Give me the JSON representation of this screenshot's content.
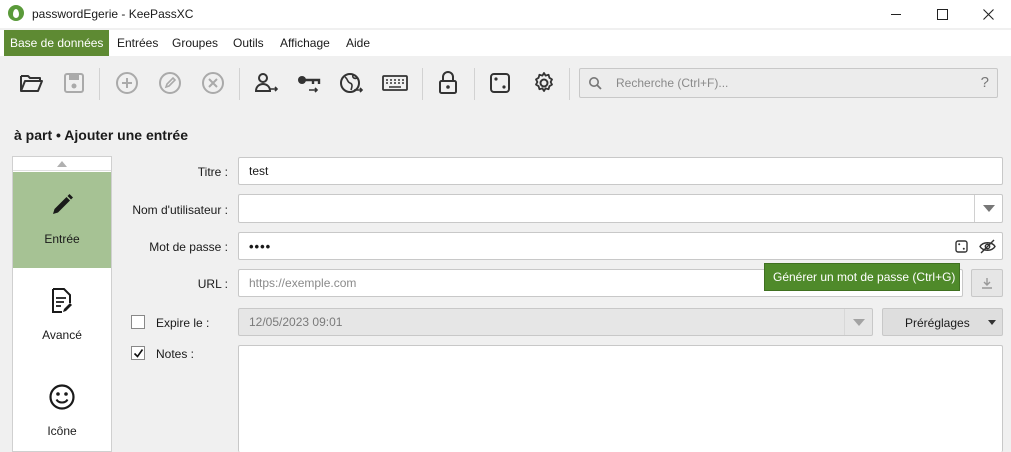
{
  "window": {
    "title": "passwordEgerie - KeePassXC"
  },
  "menu": [
    {
      "label": "Base de données",
      "active": true
    },
    {
      "label": "Entrées"
    },
    {
      "label": "Groupes"
    },
    {
      "label": "Outils"
    },
    {
      "label": "Affichage"
    },
    {
      "label": "Aide"
    }
  ],
  "toolbar": {
    "icons": [
      "open-database-icon",
      "save-database-icon",
      "add-entry-icon",
      "edit-entry-icon",
      "delete-entry-icon",
      "copy-username-icon",
      "copy-password-icon",
      "copy-url-icon",
      "autotype-icon",
      "lock-database-icon",
      "password-generator-icon",
      "settings-icon"
    ],
    "search_placeholder": "Recherche (Ctrl+F)...",
    "search_help": "?"
  },
  "page": {
    "title": "à part • Ajouter une entrée"
  },
  "sidebar": {
    "items": [
      {
        "label": "Entrée",
        "icon": "pencil-icon",
        "selected": true
      },
      {
        "label": "Avancé",
        "icon": "document-edit-icon"
      },
      {
        "label": "Icône",
        "icon": "smiley-icon"
      }
    ]
  },
  "form": {
    "title_label": "Titre :",
    "title_value": "test",
    "username_label": "Nom d'utilisateur :",
    "username_value": "",
    "password_label": "Mot de passe :",
    "password_value": "••••",
    "url_label": "URL :",
    "url_placeholder": "https://exemple.com",
    "expire_label": "Expire le :",
    "expire_checked": false,
    "expire_value": "12/05/2023 09:01",
    "presets_label": "Préréglages",
    "notes_label": "Notes :",
    "notes_checked": true,
    "notes_value": ""
  },
  "tooltip": {
    "text": "Générer un mot de passe (Ctrl+G)"
  },
  "colors": {
    "accent": "#5e8a33",
    "selected": "#a6c294",
    "tooltip": "#4f8a2a"
  }
}
